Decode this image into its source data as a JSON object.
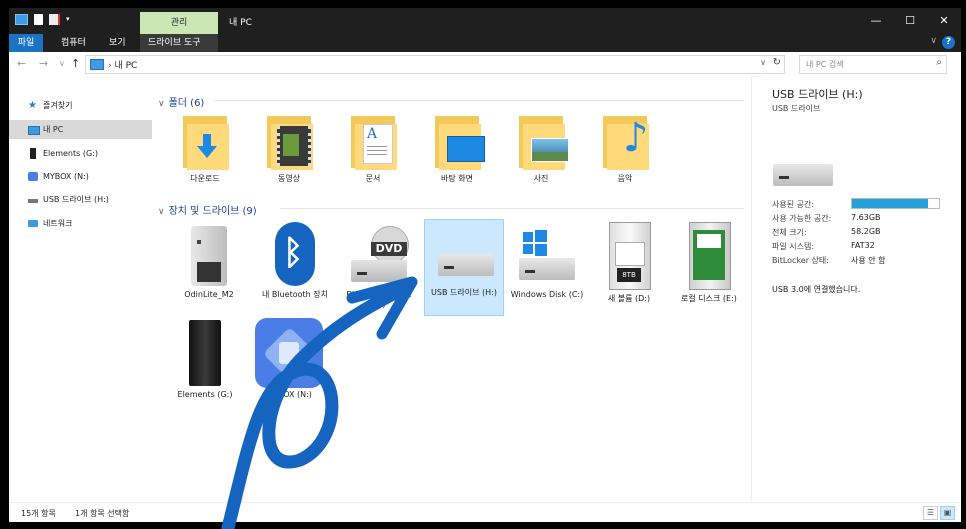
{
  "window": {
    "ribbon_context_tab": "관리",
    "title": "내 PC",
    "controls": {
      "minimize": "—",
      "maximize": "☐",
      "close": "✕"
    }
  },
  "ribbon": {
    "tabs": [
      "파일",
      "컴퓨터",
      "보기",
      "드라이브 도구"
    ],
    "help": "?"
  },
  "address": {
    "path": "내 PC",
    "search_placeholder": "내 PC 검색"
  },
  "sidebar": {
    "items": [
      {
        "label": "즐겨찾기",
        "icon": "star-icon"
      },
      {
        "label": "내 PC",
        "icon": "pc-icon"
      },
      {
        "label": "Elements (G:)",
        "icon": "drive-icon"
      },
      {
        "label": "MYBOX (N:)",
        "icon": "mybox-icon"
      },
      {
        "label": "USB 드라이브 (H:)",
        "icon": "usb-icon"
      },
      {
        "label": "네트워크",
        "icon": "network-icon"
      }
    ]
  },
  "folders": {
    "header": "폴더 (6)",
    "items": [
      {
        "label": "다운로드",
        "icon": "download-folder-icon"
      },
      {
        "label": "동영상",
        "icon": "videos-folder-icon"
      },
      {
        "label": "문서",
        "icon": "documents-folder-icon"
      },
      {
        "label": "바탕 화면",
        "icon": "desktop-folder-icon"
      },
      {
        "label": "사진",
        "icon": "pictures-folder-icon"
      },
      {
        "label": "음악",
        "icon": "music-folder-icon"
      }
    ]
  },
  "devices": {
    "header": "장치 및 드라이브 (9)",
    "items": [
      {
        "label": "OdinLite_M2",
        "icon": "server-icon"
      },
      {
        "label": "내 Bluetooth 장치",
        "icon": "bluetooth-icon"
      },
      {
        "label": "DVD RW 드라이브 (F:)",
        "icon": "dvd-drive-icon"
      },
      {
        "label": "USB 드라이브 (H:)",
        "icon": "usb-drive-icon"
      },
      {
        "label": "Windows Disk (C:)",
        "icon": "windows-disk-icon"
      },
      {
        "label": "새 볼륨 (D:)",
        "icon": "hard-disk-icon"
      },
      {
        "label": "로컬 디스크 (E:)",
        "icon": "hard-disk-green-icon"
      },
      {
        "label": "Elements (G:)",
        "icon": "external-drive-icon"
      },
      {
        "label": "MYBOX (N:)",
        "icon": "mybox-app-icon"
      }
    ]
  },
  "details": {
    "title": "USB 드라이브 (H:)",
    "subtitle": "USB 드라이브",
    "rows": [
      {
        "label": "사용된 공간:",
        "value": ""
      },
      {
        "label": "사용 가능한 공간:",
        "value": "7.63GB"
      },
      {
        "label": "전체 크기:",
        "value": "58.2GB"
      },
      {
        "label": "파일 시스템:",
        "value": "FAT32"
      },
      {
        "label": "BitLocker 상태:",
        "value": "사용 안 함"
      }
    ],
    "used_fraction": 0.87,
    "note": "USB 3.0에 연결했습니다."
  },
  "status": {
    "count": "15개 항목",
    "selected": "1개 항목 선택함"
  },
  "colors": {
    "accent": "#1a73c4",
    "selection": "#cce8ff",
    "annotation_arrow": "#1565c0"
  }
}
